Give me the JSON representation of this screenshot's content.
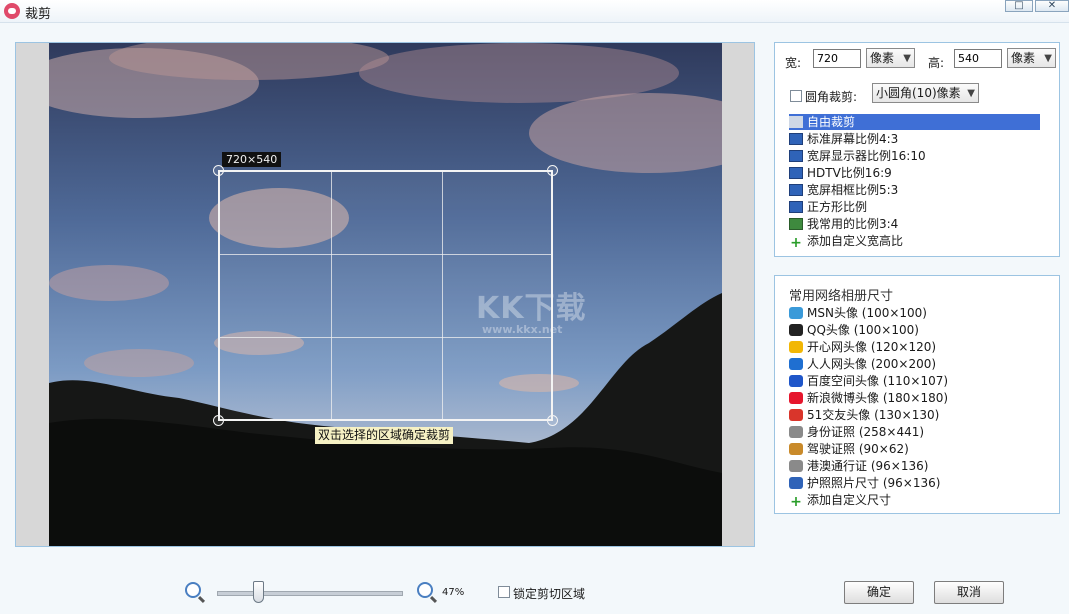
{
  "window": {
    "title": "裁剪",
    "maximize_glyph": "□",
    "close_glyph": "✕"
  },
  "canvas": {
    "size_tag": "720×540",
    "hint": "双击选择的区域确定裁剪",
    "watermark": "KK下载",
    "watermark_url": "www.kkx.net"
  },
  "settings": {
    "width_label": "宽:",
    "width_value": "720",
    "width_unit": "像素",
    "height_label": "高:",
    "height_value": "540",
    "height_unit": "像素",
    "round_corner_label": "圆角裁剪:",
    "round_corner_option": "小圆角(10)像素",
    "ratios": [
      {
        "label": "自由裁剪",
        "icon": "crosshair-icon",
        "selected": true
      },
      {
        "label": "标准屏幕比例4:3",
        "icon": "monitor-icon"
      },
      {
        "label": "宽屏显示器比例16:10",
        "icon": "monitor-icon"
      },
      {
        "label": "HDTV比例16:9",
        "icon": "monitor-icon"
      },
      {
        "label": "宽屏相框比例5:3",
        "icon": "monitor-icon"
      },
      {
        "label": "正方形比例",
        "icon": "monitor-icon"
      },
      {
        "label": "我常用的比例3:4",
        "icon": "portrait-icon"
      },
      {
        "label": "添加自定义宽高比",
        "icon": "plus-icon"
      }
    ]
  },
  "album": {
    "title": "常用网络相册尺寸",
    "items": [
      {
        "label": "MSN头像 (100×100)",
        "icon": "msn-icon",
        "color": "#3a9ad9"
      },
      {
        "label": "QQ头像 (100×100)",
        "icon": "qq-icon",
        "color": "#222222"
      },
      {
        "label": "开心网头像 (120×120)",
        "icon": "kaixin-icon",
        "color": "#f2b705"
      },
      {
        "label": "人人网头像 (200×200)",
        "icon": "renren-icon",
        "color": "#1f6fd1"
      },
      {
        "label": "百度空间头像 (110×107)",
        "icon": "baidu-icon",
        "color": "#1f56c9"
      },
      {
        "label": "新浪微博头像 (180×180)",
        "icon": "weibo-icon",
        "color": "#e6162d"
      },
      {
        "label": "51交友头像 (130×130)",
        "icon": "51-icon",
        "color": "#d9352b"
      },
      {
        "label": "身份证照 (258×441)",
        "icon": "id-card-icon",
        "color": "#8a8a8a"
      },
      {
        "label": "驾驶证照 (90×62)",
        "icon": "license-icon",
        "color": "#c98a2a"
      },
      {
        "label": "港澳通行证 (96×136)",
        "icon": "permit-icon",
        "color": "#8a8a8a"
      },
      {
        "label": "护照照片尺寸 (96×136)",
        "icon": "passport-icon",
        "color": "#2f63b8"
      },
      {
        "label": "添加自定义尺寸",
        "icon": "plus-icon",
        "color": "#2a9d2a"
      }
    ]
  },
  "footer": {
    "zoom_percent": "47%",
    "zoom_level": 0.47,
    "lock_label": "锁定剪切区域",
    "ok_label": "确定",
    "cancel_label": "取消"
  }
}
